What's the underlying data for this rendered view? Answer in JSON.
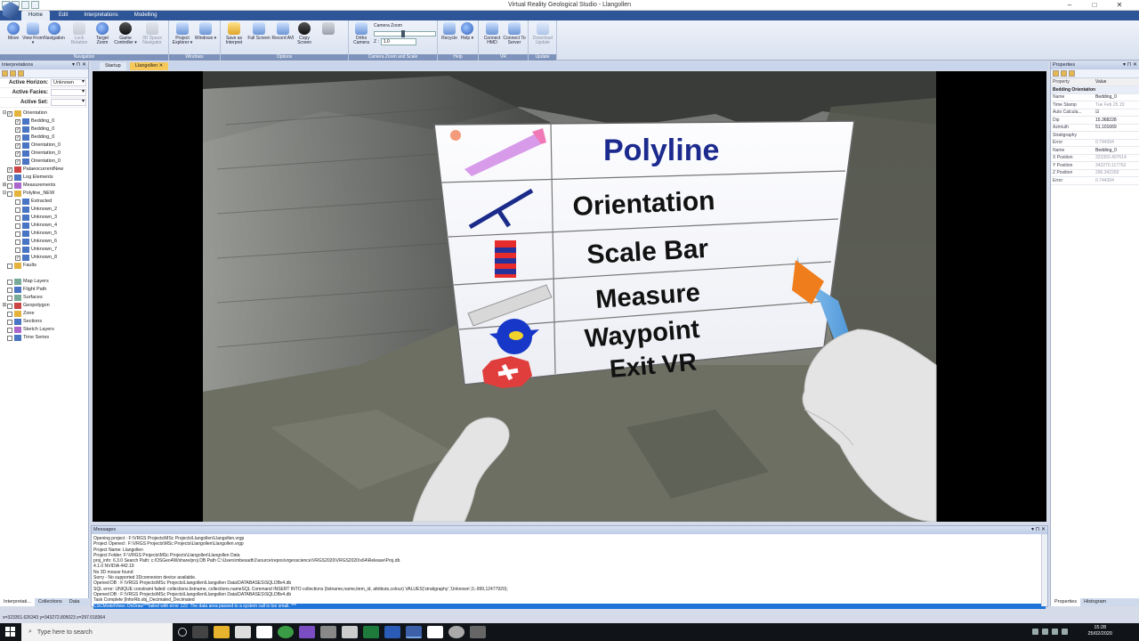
{
  "window": {
    "title": "Virtual Reality Geological Studio - Llangollen",
    "controls": [
      "–",
      "□",
      "✕"
    ]
  },
  "ribbon": {
    "tabs": [
      "Home",
      "Edit",
      "Interpretations",
      "Modelling"
    ],
    "active_tab": "Home",
    "groups": [
      {
        "label": "Navigation",
        "buttons": [
          "Move",
          "View From ▾",
          "Navigation",
          "Lock Rotation",
          "Target Zoom",
          "Game Controller ▾",
          "3D Space Navigator"
        ]
      },
      {
        "label": "Windows",
        "buttons": [
          "Project Explorer ▾",
          "Windows ▾"
        ]
      },
      {
        "label": "Options",
        "buttons": [
          "Save as Interpret",
          "Full Screen",
          "Record AVI",
          "Copy Screen"
        ]
      },
      {
        "label": "Camera Zoom and Scale",
        "buttons": [
          "Ortho Camera"
        ]
      },
      {
        "label": "Help",
        "buttons": [
          "Recycle",
          "Help ▾"
        ]
      },
      {
        "label": "VR",
        "buttons": [
          "Connect HMD",
          "Connect To Server"
        ]
      },
      {
        "label": "Update",
        "buttons": [
          "Download Update"
        ]
      }
    ],
    "camera_zoom": {
      "label": "Camera Zoom",
      "z_label": "Z :",
      "z_value": "1.0"
    }
  },
  "left_panel": {
    "header": "Interpretations",
    "fields": [
      {
        "label": "Active Horizon:",
        "value": "Unknown"
      },
      {
        "label": "Active Facies:",
        "value": ""
      },
      {
        "label": "Active Set:",
        "value": ""
      }
    ],
    "tree": [
      {
        "label": "Orientation",
        "level": 0,
        "expander": "⊟",
        "checked": true,
        "icon": "y"
      },
      {
        "label": "Bedding_0",
        "level": 1,
        "checked": true,
        "icon": "b"
      },
      {
        "label": "Bedding_0",
        "level": 1,
        "checked": true,
        "icon": "b"
      },
      {
        "label": "Bedding_0",
        "level": 1,
        "checked": true,
        "icon": "b"
      },
      {
        "label": "Orientation_0",
        "level": 1,
        "checked": true,
        "icon": "b"
      },
      {
        "label": "Orientation_0",
        "level": 1,
        "checked": true,
        "icon": "b"
      },
      {
        "label": "Orientation_0",
        "level": 1,
        "checked": true,
        "icon": "b"
      },
      {
        "label": "PalaeocurrentNew",
        "level": 0,
        "expander": "",
        "checked": true,
        "icon": "r"
      },
      {
        "label": "Log Elements",
        "level": 0,
        "expander": "",
        "checked": true,
        "icon": "b"
      },
      {
        "label": "Measurements",
        "level": 0,
        "expander": "⊞",
        "checked": false,
        "icon": "p"
      },
      {
        "label": "Polyline_NEW",
        "level": 0,
        "expander": "⊟",
        "checked": false,
        "icon": "y"
      },
      {
        "label": "Extracted",
        "level": 1,
        "checked": false,
        "icon": "b"
      },
      {
        "label": "Unknown_2",
        "level": 1,
        "checked": false,
        "icon": "b"
      },
      {
        "label": "Unknown_3",
        "level": 1,
        "checked": false,
        "icon": "b"
      },
      {
        "label": "Unknown_4",
        "level": 1,
        "checked": false,
        "icon": "b"
      },
      {
        "label": "Unknown_5",
        "level": 1,
        "checked": false,
        "icon": "b"
      },
      {
        "label": "Unknown_6",
        "level": 1,
        "checked": false,
        "icon": "b"
      },
      {
        "label": "Unknown_7",
        "level": 1,
        "checked": false,
        "icon": "b"
      },
      {
        "label": "Unknown_8",
        "level": 1,
        "checked": true,
        "icon": "b"
      },
      {
        "label": "Faults",
        "level": 0,
        "expander": "",
        "checked": false,
        "icon": "y"
      },
      {
        "label": "",
        "level": 0,
        "expander": "",
        "checked": false,
        "icon": "",
        "spacer": true
      },
      {
        "label": "Map Layers",
        "level": 0,
        "expander": "",
        "checked": false,
        "icon": "g"
      },
      {
        "label": "Flight Path",
        "level": 0,
        "expander": "",
        "checked": false,
        "icon": "b"
      },
      {
        "label": "Surfaces",
        "level": 0,
        "expander": "",
        "checked": false,
        "icon": "g"
      },
      {
        "label": "Geopolygon",
        "level": 0,
        "expander": "⊞",
        "checked": false,
        "icon": "r"
      },
      {
        "label": "Zone",
        "level": 0,
        "expander": "",
        "checked": false,
        "icon": "y"
      },
      {
        "label": "Sections",
        "level": 0,
        "expander": "",
        "checked": false,
        "icon": "b"
      },
      {
        "label": "Sketch Layers",
        "level": 0,
        "expander": "",
        "checked": false,
        "icon": "p"
      },
      {
        "label": "Time Series",
        "level": 0,
        "expander": "",
        "checked": false,
        "icon": "b"
      }
    ],
    "bottom_tabs": [
      "Interpretati...",
      "Collections",
      "Data"
    ]
  },
  "doc_tabs": [
    "Startup",
    "Llangollen"
  ],
  "vr_menu": {
    "items": [
      "Polyline",
      "Orientation",
      "Scale Bar",
      "Measure",
      "Waypoint",
      "Exit VR"
    ]
  },
  "properties": {
    "header": "Properties",
    "columns": [
      "Property",
      "Value"
    ],
    "category": "Bedding Orientation",
    "rows": [
      {
        "k": "Name",
        "v": "Bedding_0"
      },
      {
        "k": "Time Stamp",
        "v": "Tue Feb 25 15:",
        "dim": true
      },
      {
        "k": "Auto Calcula...",
        "v": "☑"
      },
      {
        "k": "Dip",
        "v": "15.368228"
      },
      {
        "k": "Azimuth",
        "v": "51.101669"
      },
      {
        "k": "Stratigraphy",
        "v": ""
      },
      {
        "k": "Error",
        "v": "0.744394",
        "dim": true
      },
      {
        "k": "Name",
        "v": "Bedding_0"
      },
      {
        "k": "X Position",
        "v": "323350.407614",
        "dim": true
      },
      {
        "k": "Y Position",
        "v": "343270.117762",
        "dim": true
      },
      {
        "k": "Z Position",
        "v": "296.342269",
        "dim": true
      },
      {
        "k": "Error",
        "v": "0.744394",
        "dim": true
      }
    ],
    "bottom_tabs": [
      "Properties",
      "Histogram"
    ]
  },
  "messages": {
    "header": "Messages",
    "lines": [
      "Opening project : F:\\VRGS Projects\\MSc Projects\\Llangollen\\Llangollen.vrgp",
      "Project Opened : F:\\VRGS Projects\\MSc Projects\\Llangollen\\Llangollen.vrgp",
      "Project Name: Llangollen",
      "Project Folder: F:\\VRGS Projects\\MSc Projects\\Llangollen\\Llangollen Data",
      "proj_info: 6.3.0 Search Path: c:/OSGeo4W/share/proj DB Path C:\\Users\\mbesadh1\\source\\repos\\vrgeoscience\\VRGS2020\\VRGS2020\\x64\\Release\\Proj.db",
      "4.1.0 NVIDIA 442.19",
      "No 3D mouse found",
      "Sorry - No supported 3Dconnexion device available.",
      "Opened DB : F:\\VRGS Projects\\MSc Projects\\Llangollen\\Llangollen Data\\DATABASES\\SQLDBv4.db",
      "SQL error: UNIQUE constraint failed: collections.listname, collections.nameSQL Command INSERT INTO collections (listname,name,item_id, attribute,colour) VALUES('stratigraphy','Unknown',0,-999,12477920);",
      "Opened DB : F:\\VRGS Projects\\MSc Projects\\Llangollen\\Llangollen Data\\DATABASES\\SQLDBv4.db",
      "Task Complete [InforRb.obj_Decimated_Decimated",
      "CSCModelView::OnDraw***failed with error 122: The data area passed to a system call is too small. ***"
    ]
  },
  "status": {
    "coords": "x=323351.626343 y=343272.805023 z=297.018364"
  },
  "taskbar": {
    "search_placeholder": "Type here to search",
    "time": "15:28",
    "date": "25/02/2020"
  }
}
